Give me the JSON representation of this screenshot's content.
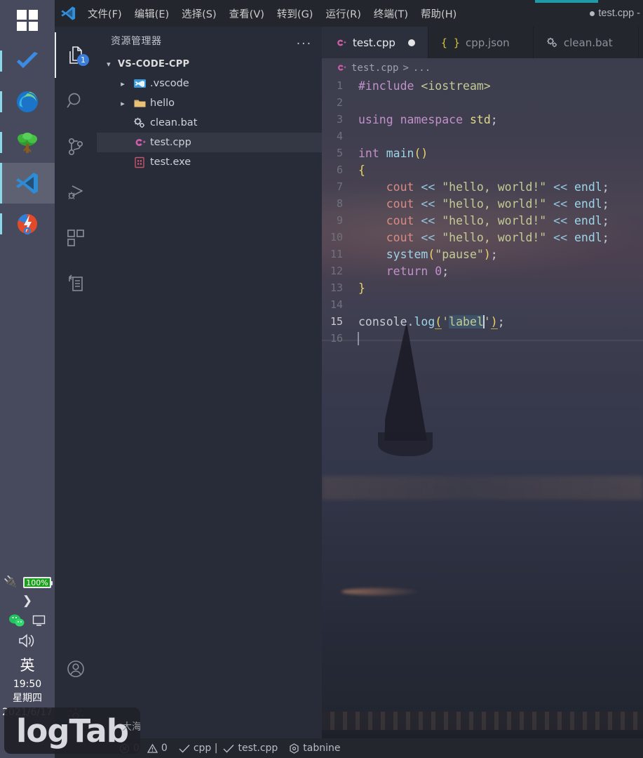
{
  "taskbar": {
    "items": [
      {
        "name": "start-button",
        "label": "Start",
        "icon": "windows-logo-icon"
      },
      {
        "name": "todo-app",
        "label": "Todo",
        "icon": "checkmark-icon"
      },
      {
        "name": "edge-browser",
        "label": "Microsoft Edge",
        "icon": "edge-icon"
      },
      {
        "name": "tree-app",
        "label": "Tree",
        "icon": "tree-icon"
      },
      {
        "name": "vscode-app",
        "label": "Visual Studio Code",
        "icon": "vscode-icon"
      },
      {
        "name": "git-app",
        "label": "Git",
        "icon": "git-icon"
      }
    ],
    "tray": {
      "battery_percent": "100%",
      "plug_icon": "power-plug-icon",
      "expand_icon": "chevron-right-icon",
      "wechat_icon": "wechat-icon",
      "display_icon": "monitor-icon",
      "volume_icon": "speaker-icon",
      "ime_label": "英",
      "clock_time": "19:50",
      "clock_weekday": "星期四",
      "clock_date": "2021/6/17"
    }
  },
  "titlebar": {
    "logo": "vscode-icon",
    "menus": [
      "文件(F)",
      "编辑(E)",
      "选择(S)",
      "查看(V)",
      "转到(G)",
      "运行(R)",
      "终端(T)",
      "帮助(H)"
    ],
    "window_title": "test.cpp -",
    "accent_color": "#1e9aa8"
  },
  "activitybar": {
    "items": [
      {
        "name": "explorer",
        "icon": "files-icon",
        "badge": "1",
        "active": true
      },
      {
        "name": "search",
        "icon": "search-icon",
        "badge": "",
        "active": false
      },
      {
        "name": "source-control",
        "icon": "source-control-icon",
        "badge": "",
        "active": false
      },
      {
        "name": "run-debug",
        "icon": "run-debug-icon",
        "badge": "",
        "active": false
      },
      {
        "name": "extensions",
        "icon": "extensions-icon",
        "badge": "",
        "active": false
      },
      {
        "name": "remote-explorer",
        "icon": "remote-explorer-icon",
        "badge": "",
        "active": false
      }
    ],
    "account_icon": "account-icon",
    "settings_icon": "gear-icon"
  },
  "sidebar": {
    "title": "资源管理器",
    "more_actions": "...",
    "root": {
      "label": "VS-CODE-CPP",
      "expanded": true,
      "chevron": "chevron-down-icon"
    },
    "files": [
      {
        "label": ".vscode",
        "icon": "vscode-folder-icon",
        "type": "folder",
        "chevron": "chevron-right-icon",
        "selected": false
      },
      {
        "label": "hello",
        "icon": "folder-icon",
        "type": "folder",
        "chevron": "chevron-right-icon",
        "selected": false
      },
      {
        "label": "clean.bat",
        "icon": "gears-icon",
        "type": "file",
        "chevron": "",
        "selected": false
      },
      {
        "label": "test.cpp",
        "icon": "cpp-icon",
        "type": "file",
        "chevron": "",
        "selected": true
      },
      {
        "label": "test.exe",
        "icon": "exe-icon",
        "type": "file",
        "chevron": "",
        "selected": false
      }
    ]
  },
  "editor": {
    "tabs": [
      {
        "label": "test.cpp",
        "icon": "cpp-icon",
        "active": true,
        "dirty": true
      },
      {
        "label": "cpp.json",
        "icon": "json-icon",
        "active": false,
        "dirty": false
      },
      {
        "label": "clean.bat",
        "icon": "gears-icon",
        "active": false,
        "dirty": false
      }
    ],
    "breadcrumb": {
      "icon": "cpp-icon",
      "file": "test.cpp",
      "separator": ">",
      "more": "..."
    },
    "lines": [
      {
        "n": "1",
        "tokens": [
          {
            "t": "#include ",
            "c": "tk-pre"
          },
          {
            "t": "<iostream>",
            "c": "tk-str"
          }
        ]
      },
      {
        "n": "2",
        "tokens": []
      },
      {
        "n": "3",
        "tokens": [
          {
            "t": "using namespace ",
            "c": "tk-kw"
          },
          {
            "t": "std",
            "c": "tk-fn"
          },
          {
            "t": ";",
            "c": "tk-pun"
          }
        ]
      },
      {
        "n": "4",
        "tokens": []
      },
      {
        "n": "5",
        "tokens": [
          {
            "t": "int ",
            "c": "tk-kw"
          },
          {
            "t": "main",
            "c": "tk-id"
          },
          {
            "t": "()",
            "c": "tk-br"
          }
        ]
      },
      {
        "n": "6",
        "tokens": [
          {
            "t": "{",
            "c": "tk-br"
          }
        ]
      },
      {
        "n": "7",
        "tokens": [
          {
            "t": "    cout",
            "c": "tk-var"
          },
          {
            "t": " << ",
            "c": "tk-op"
          },
          {
            "t": "\"hello, world!\"",
            "c": "tk-str"
          },
          {
            "t": " << ",
            "c": "tk-op"
          },
          {
            "t": "endl",
            "c": "tk-id"
          },
          {
            "t": ";",
            "c": "tk-pun"
          }
        ]
      },
      {
        "n": "8",
        "tokens": [
          {
            "t": "    cout",
            "c": "tk-var"
          },
          {
            "t": " << ",
            "c": "tk-op"
          },
          {
            "t": "\"hello, world!\"",
            "c": "tk-str"
          },
          {
            "t": " << ",
            "c": "tk-op"
          },
          {
            "t": "endl",
            "c": "tk-id"
          },
          {
            "t": ";",
            "c": "tk-pun"
          }
        ]
      },
      {
        "n": "9",
        "tokens": [
          {
            "t": "    cout",
            "c": "tk-var"
          },
          {
            "t": " << ",
            "c": "tk-op"
          },
          {
            "t": "\"hello, world!\"",
            "c": "tk-str"
          },
          {
            "t": " << ",
            "c": "tk-op"
          },
          {
            "t": "endl",
            "c": "tk-id"
          },
          {
            "t": ";",
            "c": "tk-pun"
          }
        ]
      },
      {
        "n": "10",
        "tokens": [
          {
            "t": "    cout",
            "c": "tk-var"
          },
          {
            "t": " << ",
            "c": "tk-op"
          },
          {
            "t": "\"hello, world!\"",
            "c": "tk-str"
          },
          {
            "t": " << ",
            "c": "tk-op"
          },
          {
            "t": "endl",
            "c": "tk-id"
          },
          {
            "t": ";",
            "c": "tk-pun"
          }
        ]
      },
      {
        "n": "11",
        "tokens": [
          {
            "t": "    system",
            "c": "tk-id"
          },
          {
            "t": "(",
            "c": "tk-br"
          },
          {
            "t": "\"pause\"",
            "c": "tk-str"
          },
          {
            "t": ")",
            "c": "tk-br"
          },
          {
            "t": ";",
            "c": "tk-pun"
          }
        ]
      },
      {
        "n": "12",
        "tokens": [
          {
            "t": "    return ",
            "c": "tk-kw"
          },
          {
            "t": "0",
            "c": "tk-num"
          },
          {
            "t": ";",
            "c": "tk-pun"
          }
        ]
      },
      {
        "n": "13",
        "tokens": [
          {
            "t": "}",
            "c": "tk-br"
          }
        ]
      },
      {
        "n": "14",
        "tokens": []
      },
      {
        "n": "15",
        "tokens": [
          {
            "t": "console",
            "c": "tk-plain"
          },
          {
            "t": ".",
            "c": "tk-pun"
          },
          {
            "t": "log",
            "c": "tk-id"
          },
          {
            "t": "(",
            "c": "tk-br brmatch"
          },
          {
            "t": "'",
            "c": "tk-str"
          },
          {
            "t": "label",
            "c": "tk-str sel"
          },
          {
            "t": "CARET",
            "c": "caret"
          },
          {
            "t": "'",
            "c": "tk-str"
          },
          {
            "t": ")",
            "c": "tk-br brmatch"
          },
          {
            "t": ";",
            "c": "tk-pun"
          }
        ],
        "current": true
      },
      {
        "n": "16",
        "tokens": [
          {
            "t": "CARET_DIM",
            "c": "caret"
          }
        ]
      }
    ]
  },
  "statusbar": {
    "errors_icon": "error-circle-icon",
    "errors": "0",
    "warnings_icon": "warning-triangle-icon",
    "warnings": "0",
    "lang_check_icon": "check-icon",
    "lang": "cpp |",
    "file_check_icon": "check-icon",
    "file": "test.cpp",
    "tabnine_icon": "tabnine-icon",
    "tabnine": "tabnine"
  },
  "watermark": {
    "text": "logTab",
    "suffix": "大海"
  }
}
